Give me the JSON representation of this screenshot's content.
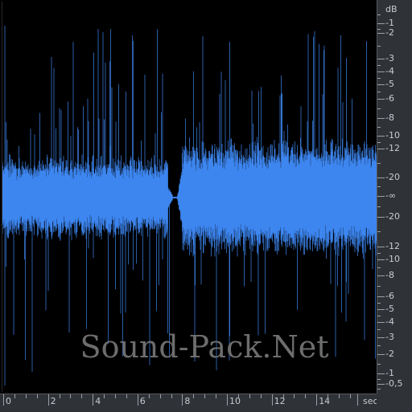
{
  "watermark": "Sound-Pack.Net",
  "colors": {
    "waveform": "#3d86f0",
    "background": "#000000",
    "ruler_bg": "#2f3338",
    "ruler_text": "#c8ccd0",
    "watermark": "#6d6d6d"
  },
  "db_ruler": {
    "unit": "dB",
    "labels": [
      "-1",
      "-2",
      "-3",
      "-4",
      "-5",
      "-6",
      "-8",
      "-10",
      "-12",
      "-20",
      "-∞",
      "-20",
      "-12",
      "-10",
      "-8",
      "-6",
      "-5",
      "-4",
      "-3",
      "-2",
      "-1",
      "-0,5"
    ]
  },
  "time_ruler": {
    "unit": "sec",
    "labels": [
      "0",
      "2",
      "4",
      "6",
      "8",
      "10",
      "12",
      "14"
    ]
  },
  "waveform": {
    "duration_sec": 16.5,
    "silence_gap_sec": [
      7.55,
      7.75
    ]
  }
}
